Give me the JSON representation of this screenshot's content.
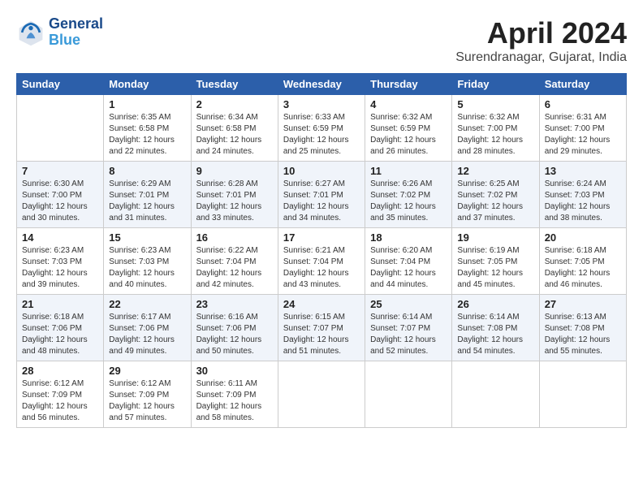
{
  "header": {
    "logo_line1": "General",
    "logo_line2": "Blue",
    "month": "April 2024",
    "location": "Surendranagar, Gujarat, India"
  },
  "weekdays": [
    "Sunday",
    "Monday",
    "Tuesday",
    "Wednesday",
    "Thursday",
    "Friday",
    "Saturday"
  ],
  "weeks": [
    [
      {
        "day": "",
        "sunrise": "",
        "sunset": "",
        "daylight": ""
      },
      {
        "day": "1",
        "sunrise": "Sunrise: 6:35 AM",
        "sunset": "Sunset: 6:58 PM",
        "daylight": "Daylight: 12 hours and 22 minutes."
      },
      {
        "day": "2",
        "sunrise": "Sunrise: 6:34 AM",
        "sunset": "Sunset: 6:58 PM",
        "daylight": "Daylight: 12 hours and 24 minutes."
      },
      {
        "day": "3",
        "sunrise": "Sunrise: 6:33 AM",
        "sunset": "Sunset: 6:59 PM",
        "daylight": "Daylight: 12 hours and 25 minutes."
      },
      {
        "day": "4",
        "sunrise": "Sunrise: 6:32 AM",
        "sunset": "Sunset: 6:59 PM",
        "daylight": "Daylight: 12 hours and 26 minutes."
      },
      {
        "day": "5",
        "sunrise": "Sunrise: 6:32 AM",
        "sunset": "Sunset: 7:00 PM",
        "daylight": "Daylight: 12 hours and 28 minutes."
      },
      {
        "day": "6",
        "sunrise": "Sunrise: 6:31 AM",
        "sunset": "Sunset: 7:00 PM",
        "daylight": "Daylight: 12 hours and 29 minutes."
      }
    ],
    [
      {
        "day": "7",
        "sunrise": "Sunrise: 6:30 AM",
        "sunset": "Sunset: 7:00 PM",
        "daylight": "Daylight: 12 hours and 30 minutes."
      },
      {
        "day": "8",
        "sunrise": "Sunrise: 6:29 AM",
        "sunset": "Sunset: 7:01 PM",
        "daylight": "Daylight: 12 hours and 31 minutes."
      },
      {
        "day": "9",
        "sunrise": "Sunrise: 6:28 AM",
        "sunset": "Sunset: 7:01 PM",
        "daylight": "Daylight: 12 hours and 33 minutes."
      },
      {
        "day": "10",
        "sunrise": "Sunrise: 6:27 AM",
        "sunset": "Sunset: 7:01 PM",
        "daylight": "Daylight: 12 hours and 34 minutes."
      },
      {
        "day": "11",
        "sunrise": "Sunrise: 6:26 AM",
        "sunset": "Sunset: 7:02 PM",
        "daylight": "Daylight: 12 hours and 35 minutes."
      },
      {
        "day": "12",
        "sunrise": "Sunrise: 6:25 AM",
        "sunset": "Sunset: 7:02 PM",
        "daylight": "Daylight: 12 hours and 37 minutes."
      },
      {
        "day": "13",
        "sunrise": "Sunrise: 6:24 AM",
        "sunset": "Sunset: 7:03 PM",
        "daylight": "Daylight: 12 hours and 38 minutes."
      }
    ],
    [
      {
        "day": "14",
        "sunrise": "Sunrise: 6:23 AM",
        "sunset": "Sunset: 7:03 PM",
        "daylight": "Daylight: 12 hours and 39 minutes."
      },
      {
        "day": "15",
        "sunrise": "Sunrise: 6:23 AM",
        "sunset": "Sunset: 7:03 PM",
        "daylight": "Daylight: 12 hours and 40 minutes."
      },
      {
        "day": "16",
        "sunrise": "Sunrise: 6:22 AM",
        "sunset": "Sunset: 7:04 PM",
        "daylight": "Daylight: 12 hours and 42 minutes."
      },
      {
        "day": "17",
        "sunrise": "Sunrise: 6:21 AM",
        "sunset": "Sunset: 7:04 PM",
        "daylight": "Daylight: 12 hours and 43 minutes."
      },
      {
        "day": "18",
        "sunrise": "Sunrise: 6:20 AM",
        "sunset": "Sunset: 7:04 PM",
        "daylight": "Daylight: 12 hours and 44 minutes."
      },
      {
        "day": "19",
        "sunrise": "Sunrise: 6:19 AM",
        "sunset": "Sunset: 7:05 PM",
        "daylight": "Daylight: 12 hours and 45 minutes."
      },
      {
        "day": "20",
        "sunrise": "Sunrise: 6:18 AM",
        "sunset": "Sunset: 7:05 PM",
        "daylight": "Daylight: 12 hours and 46 minutes."
      }
    ],
    [
      {
        "day": "21",
        "sunrise": "Sunrise: 6:18 AM",
        "sunset": "Sunset: 7:06 PM",
        "daylight": "Daylight: 12 hours and 48 minutes."
      },
      {
        "day": "22",
        "sunrise": "Sunrise: 6:17 AM",
        "sunset": "Sunset: 7:06 PM",
        "daylight": "Daylight: 12 hours and 49 minutes."
      },
      {
        "day": "23",
        "sunrise": "Sunrise: 6:16 AM",
        "sunset": "Sunset: 7:06 PM",
        "daylight": "Daylight: 12 hours and 50 minutes."
      },
      {
        "day": "24",
        "sunrise": "Sunrise: 6:15 AM",
        "sunset": "Sunset: 7:07 PM",
        "daylight": "Daylight: 12 hours and 51 minutes."
      },
      {
        "day": "25",
        "sunrise": "Sunrise: 6:14 AM",
        "sunset": "Sunset: 7:07 PM",
        "daylight": "Daylight: 12 hours and 52 minutes."
      },
      {
        "day": "26",
        "sunrise": "Sunrise: 6:14 AM",
        "sunset": "Sunset: 7:08 PM",
        "daylight": "Daylight: 12 hours and 54 minutes."
      },
      {
        "day": "27",
        "sunrise": "Sunrise: 6:13 AM",
        "sunset": "Sunset: 7:08 PM",
        "daylight": "Daylight: 12 hours and 55 minutes."
      }
    ],
    [
      {
        "day": "28",
        "sunrise": "Sunrise: 6:12 AM",
        "sunset": "Sunset: 7:09 PM",
        "daylight": "Daylight: 12 hours and 56 minutes."
      },
      {
        "day": "29",
        "sunrise": "Sunrise: 6:12 AM",
        "sunset": "Sunset: 7:09 PM",
        "daylight": "Daylight: 12 hours and 57 minutes."
      },
      {
        "day": "30",
        "sunrise": "Sunrise: 6:11 AM",
        "sunset": "Sunset: 7:09 PM",
        "daylight": "Daylight: 12 hours and 58 minutes."
      },
      {
        "day": "",
        "sunrise": "",
        "sunset": "",
        "daylight": ""
      },
      {
        "day": "",
        "sunrise": "",
        "sunset": "",
        "daylight": ""
      },
      {
        "day": "",
        "sunrise": "",
        "sunset": "",
        "daylight": ""
      },
      {
        "day": "",
        "sunrise": "",
        "sunset": "",
        "daylight": ""
      }
    ]
  ]
}
